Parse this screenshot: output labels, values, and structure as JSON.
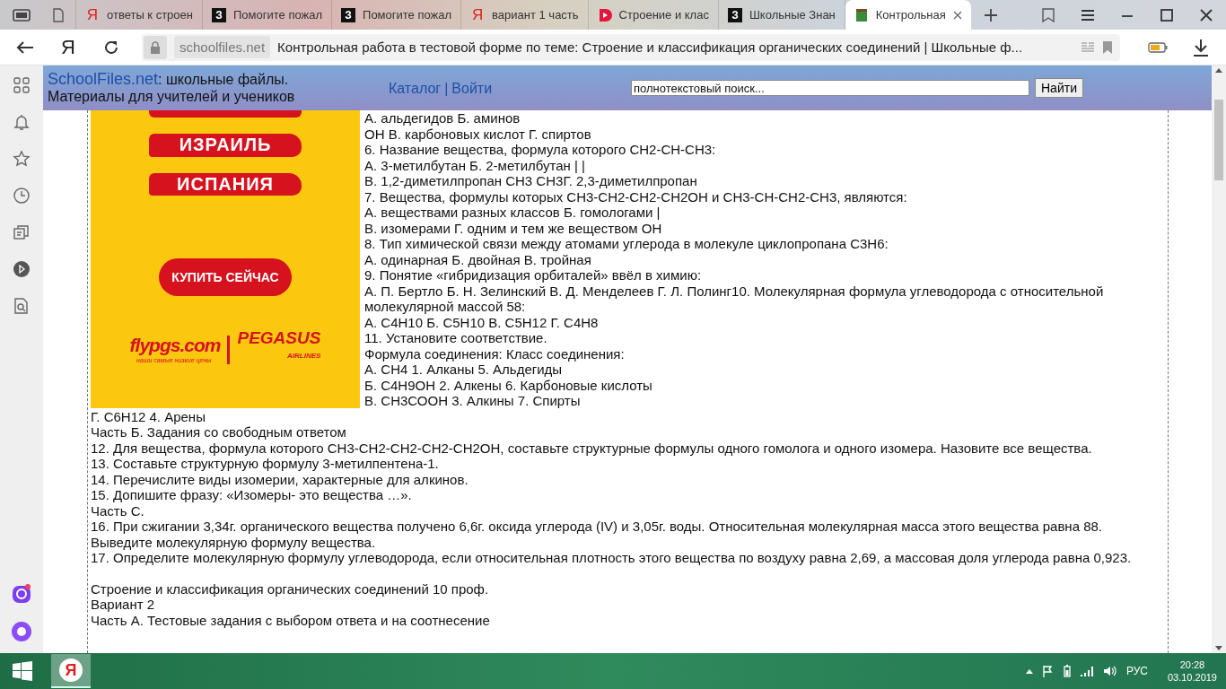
{
  "browser": {
    "tabs": [
      {
        "kind": "page",
        "selected": false
      },
      {
        "kind": "yandex",
        "glyph": "Я",
        "title": "ответы к строен",
        "selected": false
      },
      {
        "kind": "znanija",
        "glyph": "З",
        "title": "Помогите пожал",
        "selected": false
      },
      {
        "kind": "znanija",
        "glyph": "З",
        "title": "Помогите пожал",
        "selected": false
      },
      {
        "kind": "yandex",
        "glyph": "Я",
        "title": "вариант 1 часть",
        "selected": false
      },
      {
        "kind": "play",
        "title": "Строение и клас",
        "selected": false
      },
      {
        "kind": "znanija",
        "glyph": "З",
        "title": "Школьные Знан",
        "selected": false
      },
      {
        "kind": "book",
        "title": "Контрольная",
        "selected": true
      }
    ],
    "home_glyph": "Я",
    "address": {
      "domain": "schoolfiles.net",
      "title": "Контрольная работа в тестовой форме по теме: Строение и классификация органических соединений | Школьные ф..."
    }
  },
  "site_header": {
    "brand": "SchoolFiles.net",
    "tagline": ": школьные файлы.",
    "subtitle": "Материалы для учителей и учеников",
    "links": [
      "Каталог",
      "Войти"
    ],
    "separator": "|",
    "search": {
      "value": "полнотекстовый поиск..."
    },
    "search_button": "Найти"
  },
  "ad": {
    "destinations": [
      "ИЗРАИЛЬ",
      "ИСПАНИЯ"
    ],
    "cta": "КУПИТЬ СЕЙЧАС",
    "site": "flypgs.com",
    "brand": "PEGASUS",
    "brand_sub": "AIRLINES",
    "slogan": "наши самые низкие цены"
  },
  "article": [
    {
      "lines": [
        "А. альдегидов Б. аминов",
        "ОН В. карбоновых кислот Г. спиртов",
        "6. Название вещества, формула которого СН2-СН-СН3:",
        "А. 3-метилбутан Б. 2-метилбутан | |",
        "В. 1,2-диметилпропан СН3 СН3Г. 2,3-диметилпропан",
        "7. Вещества, формулы которых СН3-СН2-СН2-СН2ОН и СН3-СН-СН2-СН3, являются:",
        "А. веществами разных классов Б. гомологами |",
        "В. изомерами Г. одним и тем же веществом ОН",
        "8. Тип химической связи между атомами углерода в молекуле циклопропана С3Н6:",
        "А. одинарная Б. двойная В. тройная",
        "9. Понятие «гибридизация орбиталей» ввёл в химию:",
        "А. П. Бертло Б. Н. Зелинский В. Д. Менделеев Г. Л. Полинг10. Молекулярная формула углеводорода с относительной молекулярной массой 58:",
        "А. С4Н10 Б. С5Н10 В. С5Н12 Г. С4Н8",
        "11. Установите соответствие.",
        "Формула соединения: Класс соединения:",
        "А. СН4 1. Алканы 5. Альдегиды",
        "Б. С4Н9ОН 2. Алкены 6. Карбоновые кислоты",
        "В. СН3СООН 3. Алкины 7. Спирты",
        "Г. С6Н12 4. Арены",
        "Часть Б. Задания со свободным ответом",
        "12. Для вещества, формула которого СН3-СН2-СН2-СН2-СН2ОН, составьте структурные формулы одного гомолога и одного изомера. Назовите все вещества.",
        "13. Составьте структурную формулу 3-метилпентена-1.",
        "14. Перечислите виды изомерии, характерные для алкинов.",
        "15. Допишите фразу: «Изомеры- это вещества …».",
        "Часть С.",
        "16. При сжигании 3,34г. органического вещества получено 6,6г. оксида углерода (IV) и 3,05г. воды. Относительная молекулярная масса этого вещества равна 88. Выведите молекулярную формулу вещества.",
        "17. Определите молекулярную формулу углеводорода, если относительная плотность этого вещества по воздуху равна 2,69, а массовая доля углерода равна 0,923."
      ]
    },
    {
      "lines": [
        "Строение и классификация органических соединений 10 проф.",
        "Вариант 2",
        "Часть А. Тестовые задания с выбором ответа и на соотнесение"
      ]
    }
  ],
  "taskbar": {
    "language": "РУС",
    "time": "20:28",
    "date": "03.10.2019",
    "logo_glyph": "Я"
  }
}
